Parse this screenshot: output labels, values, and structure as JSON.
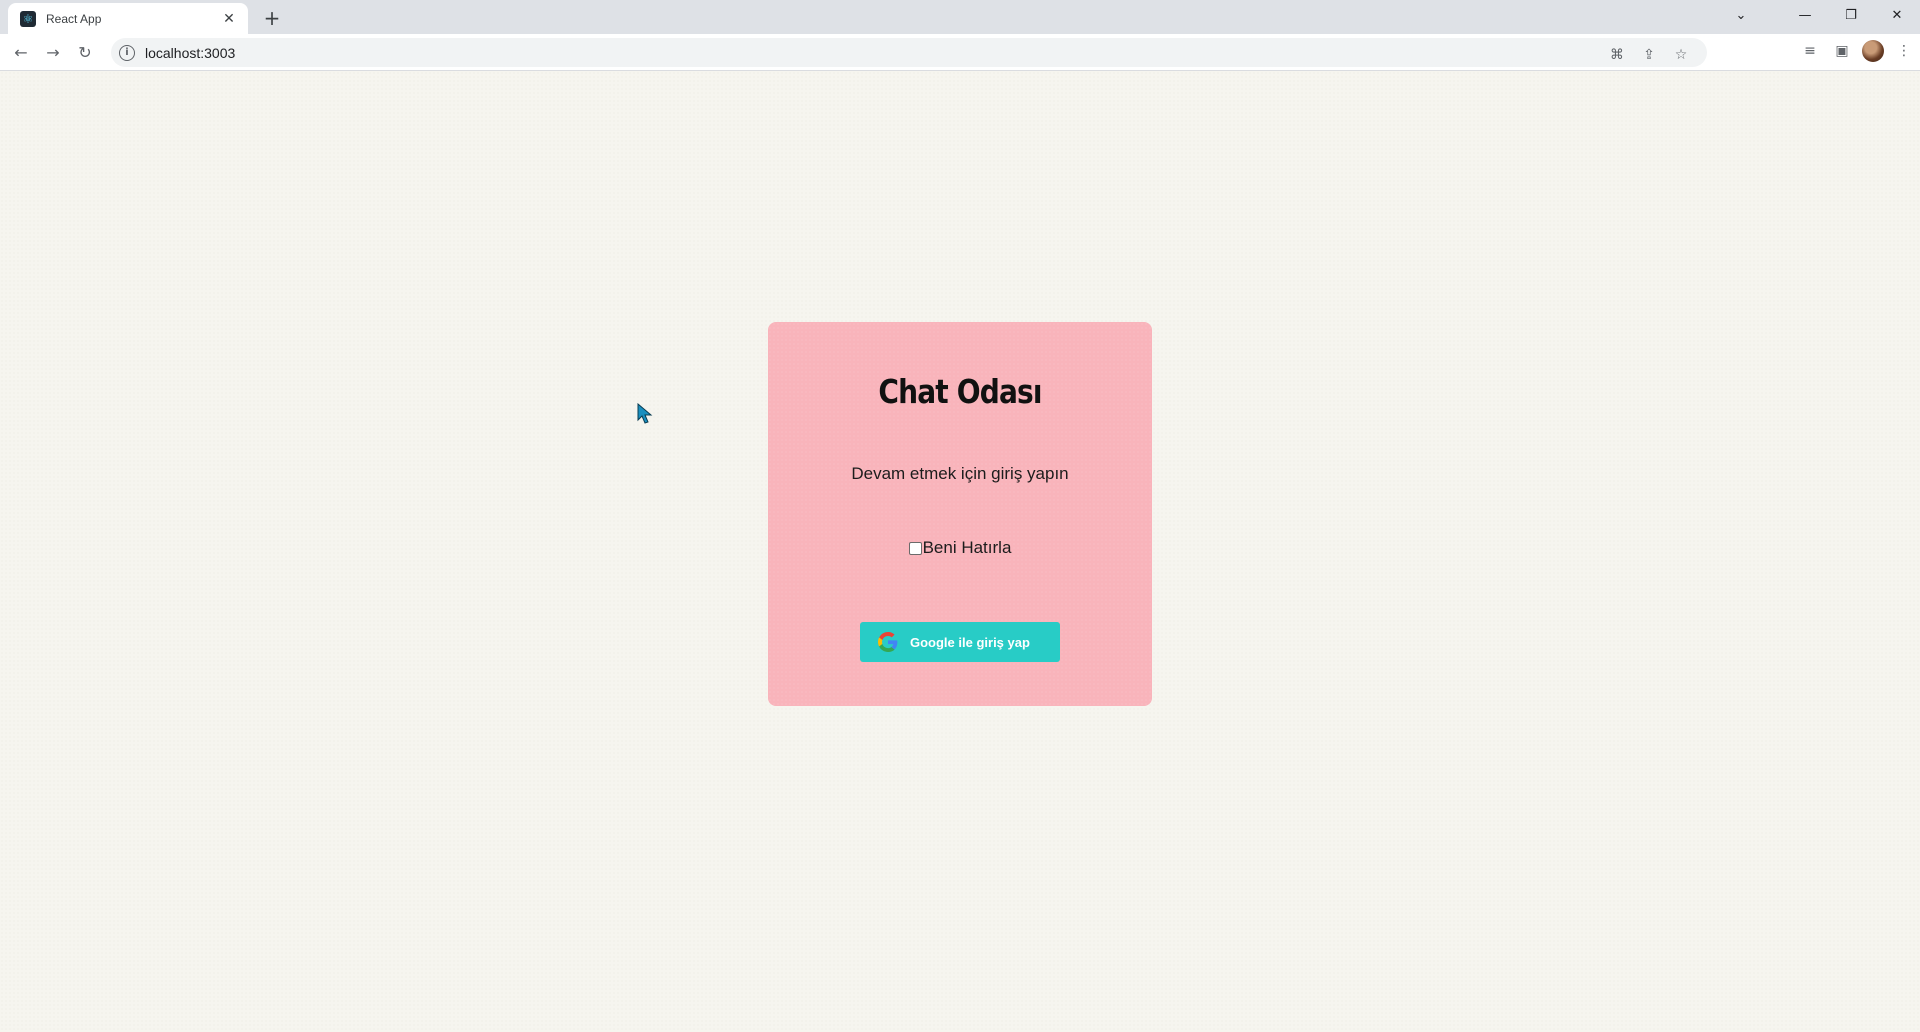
{
  "browser": {
    "tab_title": "React App",
    "url": "localhost:3003"
  },
  "card": {
    "title": "Chat Odası",
    "subtitle": "Devam etmek için giriş yapın",
    "remember_label": "Beni Hatırla",
    "remember_checked": false,
    "google_button_label": "Google ile giriş yap"
  },
  "colors": {
    "card_background": "#f9b4bb",
    "button_background": "#28ccc6",
    "page_background": "#f6f5ef"
  }
}
